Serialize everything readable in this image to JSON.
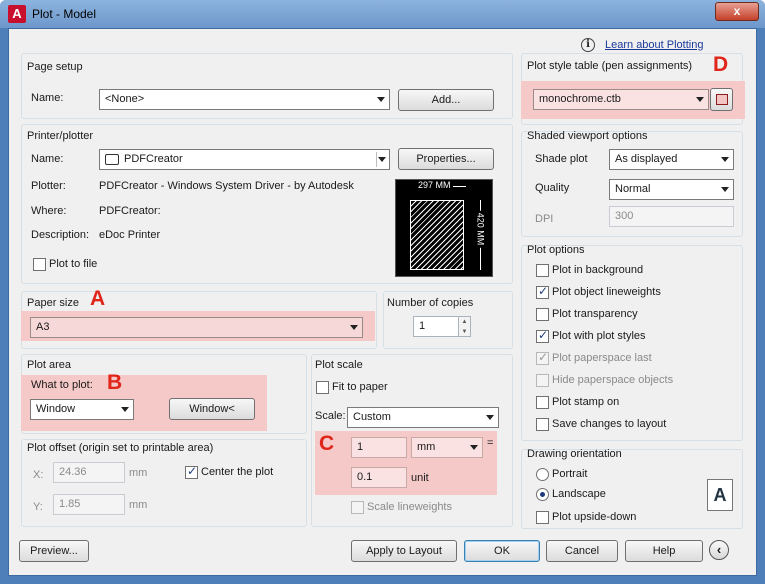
{
  "window": {
    "title": "Plot - Model",
    "app_icon": "A",
    "close": "x"
  },
  "help_link": "Learn about Plotting",
  "annotations": {
    "a": "A",
    "b": "B",
    "c": "C",
    "d": "D"
  },
  "page_setup": {
    "legend": "Page setup",
    "name_label": "Name:",
    "name_value": "<None>",
    "add_button": "Add..."
  },
  "printer": {
    "legend": "Printer/plotter",
    "name_label": "Name:",
    "name_value": "PDFCreator",
    "properties_button": "Properties...",
    "plotter_label": "Plotter:",
    "plotter_value": "PDFCreator - Windows System Driver - by Autodesk",
    "where_label": "Where:",
    "where_value": "PDFCreator:",
    "description_label": "Description:",
    "description_value": "eDoc Printer",
    "plot_to_file_label": "Plot to file",
    "plot_to_file_checked": false,
    "preview_width": "297 MM",
    "preview_height": "420 MM"
  },
  "paper_size": {
    "legend": "Paper size",
    "value": "A3"
  },
  "copies": {
    "legend": "Number of copies",
    "value": "1"
  },
  "plot_area": {
    "legend": "Plot area",
    "what_label": "What to plot:",
    "what_value": "Window",
    "window_button": "Window<"
  },
  "plot_offset": {
    "legend": "Plot offset (origin set to printable area)",
    "x_label": "X:",
    "x_value": "24.36",
    "x_unit": "mm",
    "y_label": "Y:",
    "y_value": "1.85",
    "y_unit": "mm",
    "center_label": "Center the plot",
    "center_checked": true
  },
  "plot_scale": {
    "legend": "Plot scale",
    "fit_label": "Fit to paper",
    "fit_checked": false,
    "scale_label": "Scale:",
    "scale_value": "Custom",
    "value1": "1",
    "unit1": "mm",
    "equals": "=",
    "value2": "0.1",
    "unit2": "unit",
    "lineweights_label": "Scale lineweights"
  },
  "plot_style": {
    "legend": "Plot style table (pen assignments)",
    "value": "monochrome.ctb"
  },
  "shaded": {
    "legend": "Shaded viewport options",
    "shade_label": "Shade plot",
    "shade_value": "As displayed",
    "quality_label": "Quality",
    "quality_value": "Normal",
    "dpi_label": "DPI",
    "dpi_value": "300"
  },
  "plot_options": {
    "legend": "Plot options",
    "items": [
      {
        "label": "Plot in background",
        "checked": false,
        "disabled": false
      },
      {
        "label": "Plot object lineweights",
        "checked": true,
        "disabled": false
      },
      {
        "label": "Plot transparency",
        "checked": false,
        "disabled": false
      },
      {
        "label": "Plot with plot styles",
        "checked": true,
        "disabled": false
      },
      {
        "label": "Plot paperspace last",
        "checked": true,
        "disabled": true
      },
      {
        "label": "Hide paperspace objects",
        "checked": false,
        "disabled": true
      },
      {
        "label": "Plot stamp on",
        "checked": false,
        "disabled": false
      },
      {
        "label": "Save changes to layout",
        "checked": false,
        "disabled": false
      }
    ]
  },
  "orientation": {
    "legend": "Drawing orientation",
    "portrait_label": "Portrait",
    "landscape_label": "Landscape",
    "selected": "Landscape",
    "upside_label": "Plot upside-down",
    "upside_checked": false,
    "icon_letter": "A"
  },
  "buttons": {
    "preview": "Preview...",
    "apply": "Apply to Layout",
    "ok": "OK",
    "cancel": "Cancel",
    "help": "Help"
  }
}
